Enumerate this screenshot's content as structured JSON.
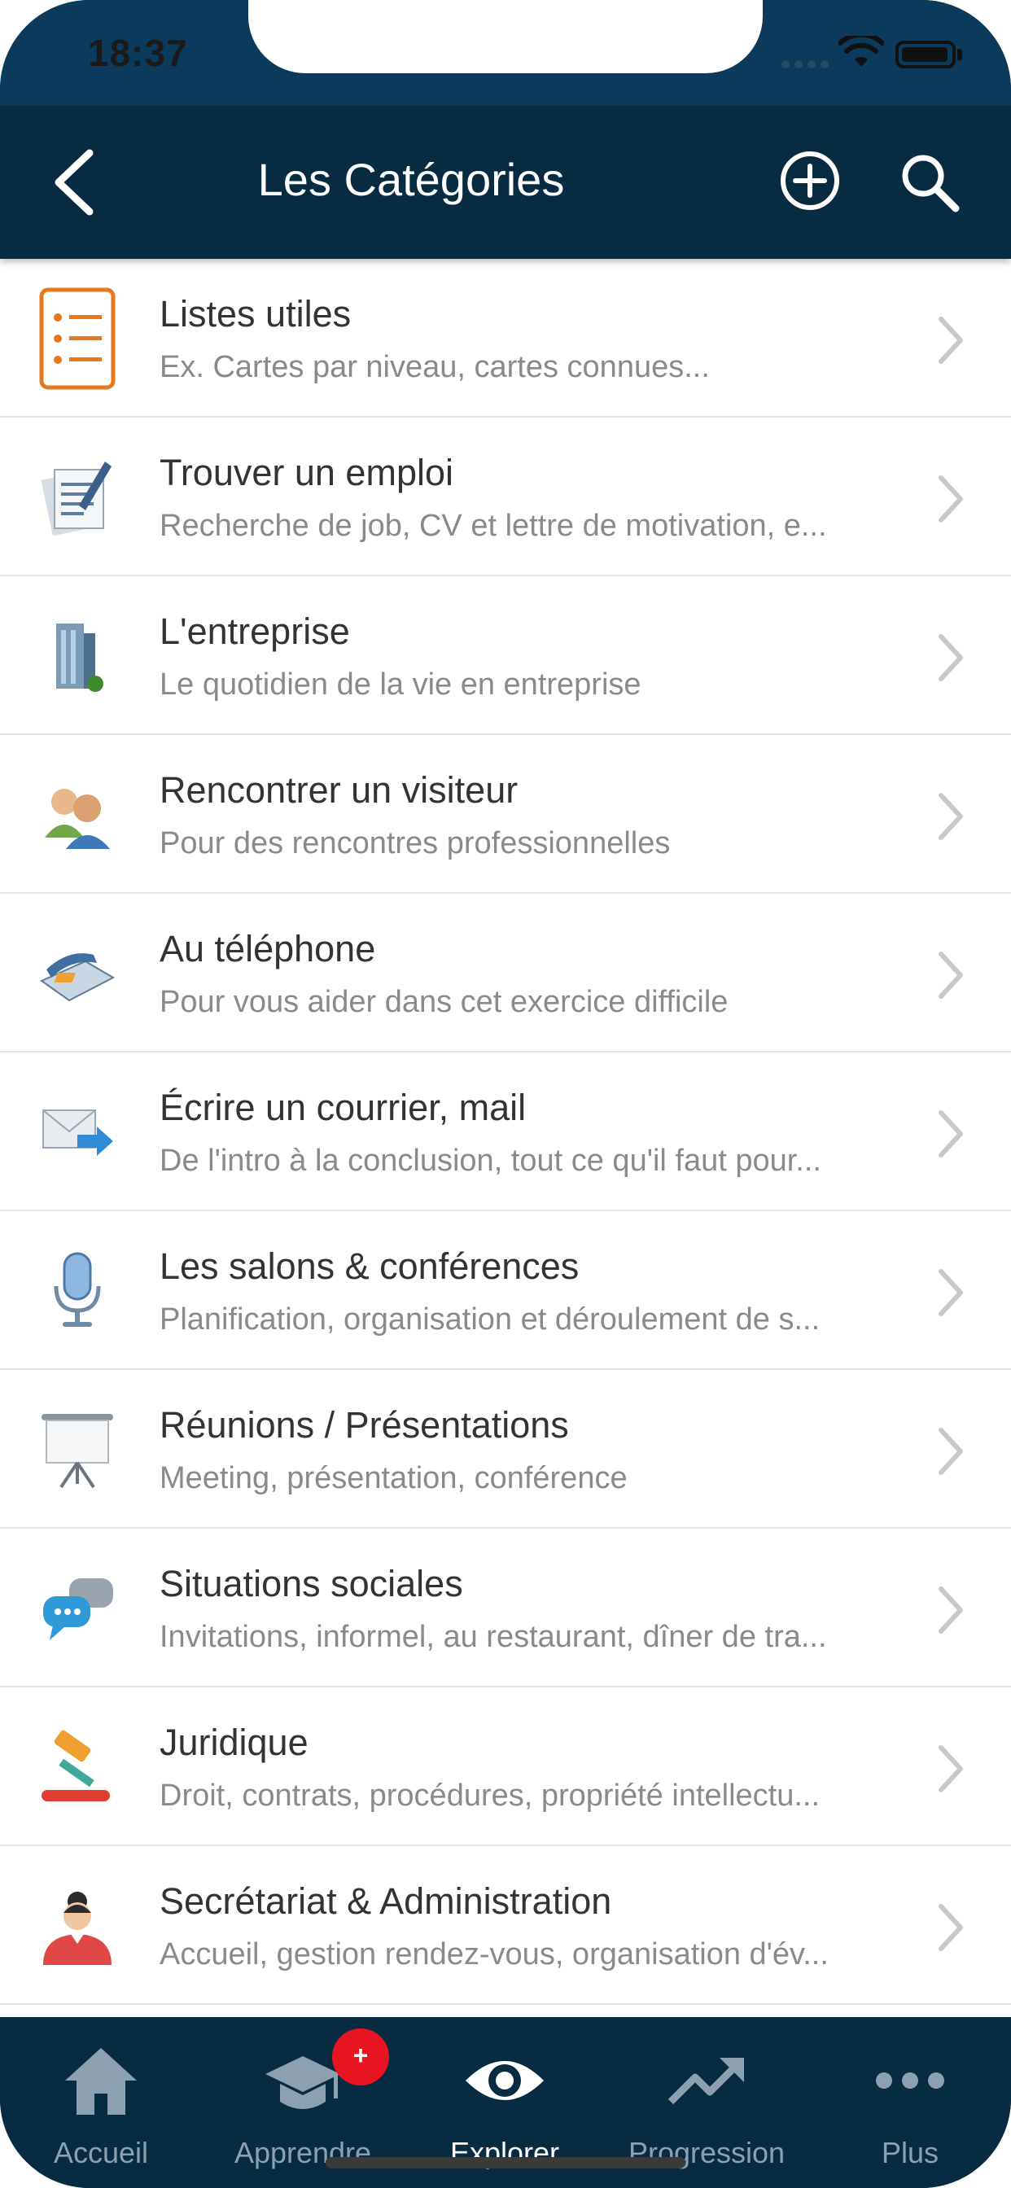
{
  "status_bar": {
    "time": "18:37"
  },
  "navbar": {
    "title": "Les Catégories"
  },
  "categories": [
    {
      "title": "Listes utiles",
      "subtitle": "Ex. Cartes par niveau, cartes connues...",
      "icon": "list-icon"
    },
    {
      "title": "Trouver un emploi",
      "subtitle": "Recherche de job, CV et lettre de motivation, e...",
      "icon": "document-pencil-icon"
    },
    {
      "title": "L'entreprise",
      "subtitle": "Le quotidien de la vie en entreprise",
      "icon": "building-icon"
    },
    {
      "title": "Rencontrer un visiteur",
      "subtitle": "Pour des rencontres professionnelles",
      "icon": "people-icon"
    },
    {
      "title": "Au téléphone",
      "subtitle": "Pour vous aider dans cet exercice difficile",
      "icon": "telephone-icon"
    },
    {
      "title": "Écrire un courrier, mail",
      "subtitle": "De l'intro à la conclusion, tout ce qu'il faut pour...",
      "icon": "mail-arrow-icon"
    },
    {
      "title": "Les salons & conférences",
      "subtitle": "Planification, organisation et déroulement de s...",
      "icon": "microphone-icon"
    },
    {
      "title": "Réunions / Présentations",
      "subtitle": "Meeting, présentation, conférence",
      "icon": "presentation-board-icon"
    },
    {
      "title": "Situations sociales",
      "subtitle": "Invitations, informel, au restaurant, dîner de tra...",
      "icon": "chat-bubbles-icon"
    },
    {
      "title": "Juridique",
      "subtitle": "Droit, contrats, procédures, propriété intellectu...",
      "icon": "gavel-icon"
    },
    {
      "title": "Secrétariat & Administration",
      "subtitle": "Accueil, gestion rendez-vous, organisation d'év...",
      "icon": "secretary-icon"
    }
  ],
  "tabbar": {
    "tabs": [
      {
        "label": "Accueil",
        "icon": "home-icon"
      },
      {
        "label": "Apprendre",
        "icon": "graduation-cap-icon"
      },
      {
        "label": "Explorer",
        "icon": "eye-icon",
        "active": true
      },
      {
        "label": "Progression",
        "icon": "trending-up-icon"
      },
      {
        "label": "Plus",
        "icon": "more-dots-icon"
      }
    ],
    "badge": "+"
  },
  "colors": {
    "navbar_bg": "#072b40",
    "accent_orange": "#e8761a",
    "badge_red": "#e8141f"
  }
}
